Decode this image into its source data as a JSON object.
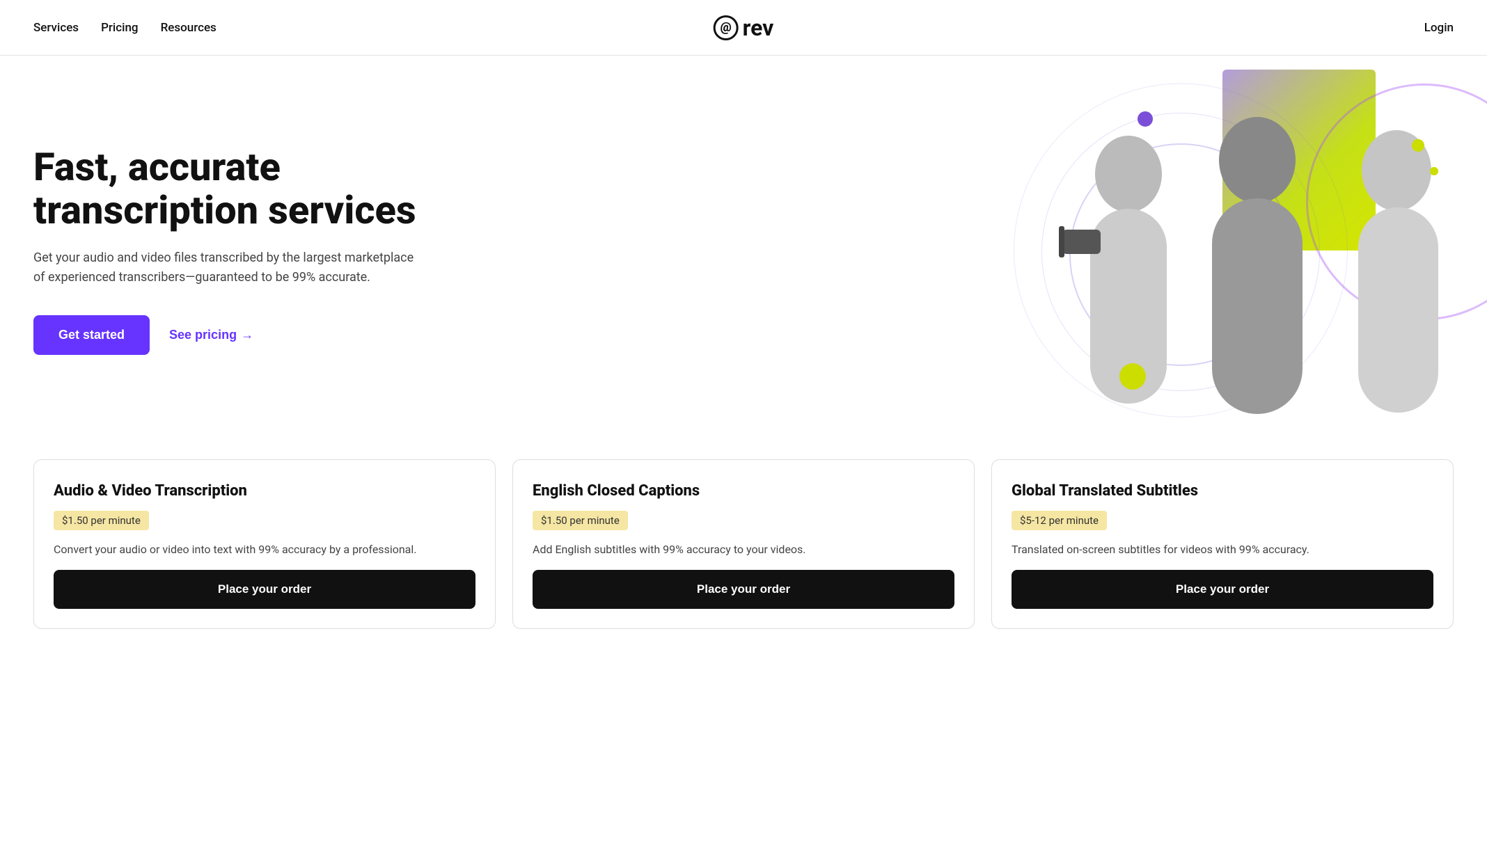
{
  "nav": {
    "links": [
      {
        "label": "Services",
        "key": "services"
      },
      {
        "label": "Pricing",
        "key": "pricing"
      },
      {
        "label": "Resources",
        "key": "resources"
      }
    ],
    "logo_text": "rev",
    "login_label": "Login"
  },
  "hero": {
    "title": "Fast, accurate transcription services",
    "subtitle": "Get your audio and video files transcribed by the largest marketplace of experienced transcribers—guaranteed to be 99% accurate.",
    "cta_primary": "Get started",
    "cta_secondary": "See pricing",
    "cta_arrow": "→"
  },
  "cards": [
    {
      "title": "Audio & Video Transcription",
      "price": "$1.50 per minute",
      "description": "Convert your audio or video into text with 99% accuracy by a professional.",
      "cta": "Place your order"
    },
    {
      "title": "English Closed Captions",
      "price": "$1.50 per minute",
      "description": "Add English subtitles with 99% accuracy to your videos.",
      "cta": "Place your order"
    },
    {
      "title": "Global Translated Subtitles",
      "price": "$5-12 per minute",
      "description": "Translated on-screen subtitles for videos with 99% accuracy.",
      "cta": "Place your order"
    }
  ]
}
